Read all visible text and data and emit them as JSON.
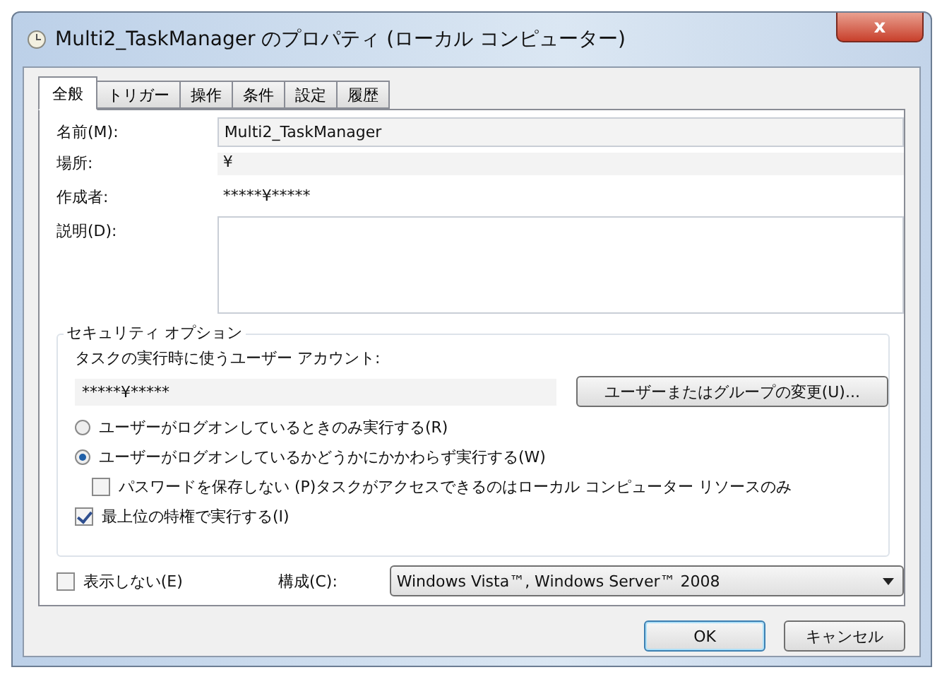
{
  "window": {
    "title": "Multi2_TaskManager のプロパティ (ローカル コンピューター)",
    "close": "x"
  },
  "tabs": [
    {
      "label": "全般",
      "selected": true
    },
    {
      "label": "トリガー",
      "selected": false
    },
    {
      "label": "操作",
      "selected": false
    },
    {
      "label": "条件",
      "selected": false
    },
    {
      "label": "設定",
      "selected": false
    },
    {
      "label": "履歴",
      "selected": false
    }
  ],
  "general": {
    "fields": [
      {
        "kind": "input",
        "label": "名前(M):",
        "value": "Multi2_TaskManager"
      },
      {
        "kind": "readonly",
        "label": "場所:",
        "value": "¥"
      },
      {
        "kind": "text",
        "label": "作成者:",
        "value": "*****¥*****"
      },
      {
        "kind": "textarea",
        "label": "説明(D):"
      }
    ],
    "security": {
      "legend": "セキュリティ オプション",
      "account_label": "タスクの実行時に使うユーザー アカウント:",
      "account": "*****¥*****",
      "change_button": "ユーザーまたはグループの変更(U)...",
      "options": [
        {
          "kind": "radio",
          "label": "ユーザーがログオンしているときのみ実行する(R)",
          "selected": false
        },
        {
          "kind": "radio",
          "label": "ユーザーがログオンしているかどうかにかかわらず実行する(W)",
          "selected": true,
          "children": [
            {
              "kind": "checkbox",
              "label": "パスワードを保存しない (P)タスクがアクセスできるのはローカル コンピューター リソースのみ",
              "checked": false
            }
          ]
        },
        {
          "kind": "checkbox",
          "label": "最上位の特権で実行する(I)",
          "checked": true
        }
      ]
    },
    "hidden": {
      "label": "表示しない(E)",
      "checked": false
    },
    "configure": {
      "label": "構成(C):",
      "value": "Windows Vista™, Windows Server™ 2008"
    }
  },
  "buttons": [
    {
      "label": "OK",
      "default": true
    },
    {
      "label": "キャンセル",
      "default": false
    }
  ]
}
